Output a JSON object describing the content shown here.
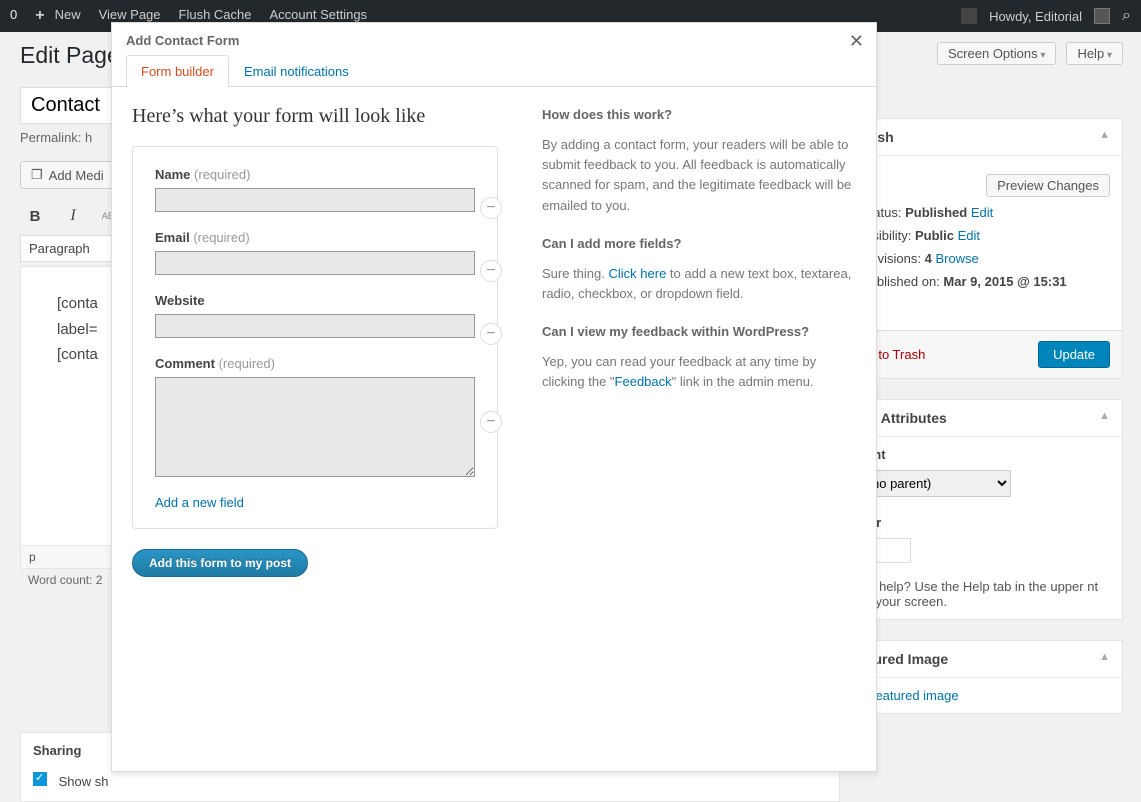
{
  "adminbar": {
    "zero": "0",
    "new": "New",
    "view_page": "View Page",
    "flush_cache": "Flush Cache",
    "account_settings": "Account Settings",
    "howdy": "Howdy, Editorial"
  },
  "page": {
    "title_h1": "Edit Page",
    "title_value": "Contact",
    "permalink_label": "Permalink: h",
    "add_media": "Add Medi",
    "paragraph": "Paragraph",
    "editor_line1": "[conta",
    "editor_line2": "label=",
    "editor_line3": "[conta",
    "status_p": "p",
    "word_count": "Word count: 2"
  },
  "top_buttons": {
    "screen_options": "Screen Options",
    "help": "Help"
  },
  "publish": {
    "box_title": "blish",
    "preview": "Preview Changes",
    "status_label": "Status: ",
    "status_value": "Published",
    "visibility_label": "Visibility: ",
    "visibility_value": "Public",
    "revisions_label": "Revisions: ",
    "revisions_value": "4",
    "browse": "Browse",
    "published_on_label": "Published on: ",
    "published_on_value": "Mar 9, 2015 @ 15:31",
    "edit": "Edit",
    "cut_t": "t",
    "trash": "ve to Trash",
    "update": "Update"
  },
  "attributes": {
    "box_title": "ge Attributes",
    "parent_label": "rent",
    "parent_value": "no parent)",
    "order_label": "der",
    "help_text": "ed help? Use the Help tab in the upper nt of your screen."
  },
  "featured": {
    "box_title": "atured Image",
    "link": "a featured image"
  },
  "sharing": {
    "box_title": "Sharing",
    "option": "Show sh"
  },
  "modal": {
    "title": "Add Contact Form",
    "tab_form_builder": "Form builder",
    "tab_email": "Email notifications",
    "preview_heading": "Here’s what your form will look like",
    "fields": {
      "name": {
        "label": "Name",
        "req": "(required)"
      },
      "email": {
        "label": "Email",
        "req": "(required)"
      },
      "website": {
        "label": "Website"
      },
      "comment": {
        "label": "Comment",
        "req": "(required)"
      }
    },
    "add_new_field": "Add a new field",
    "add_form_btn": "Add this form to my post",
    "help": {
      "q1": "How does this work?",
      "a1": "By adding a contact form, your readers will be able to submit feedback to you. All feedback is automatically scanned for spam, and the legitimate feedback will be emailed to you.",
      "q2": "Can I add more fields?",
      "a2a": "Sure thing. ",
      "a2_link": "Click here",
      "a2b": " to add a new text box, textarea, radio, checkbox, or dropdown field.",
      "q3": "Can I view my feedback within WordPress?",
      "a3a": "Yep, you can read your feedback at any time by clicking the \"",
      "a3_link": "Feedback",
      "a3b": "\" link in the admin menu."
    }
  }
}
